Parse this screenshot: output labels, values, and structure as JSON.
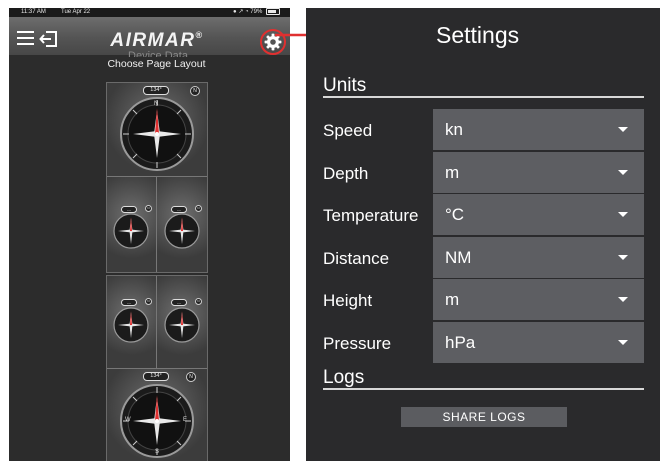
{
  "status_bar": {
    "time": "11:37 AM",
    "date": "Tue Apr 22",
    "indicators": "● ↗ ◔ 79%",
    "battery_percent": 79
  },
  "app_bar": {
    "logo_text": "AIRMAR",
    "logo_mark": "®",
    "subtitle": "Device Data",
    "menu_icon": "hamburger-icon",
    "exit_icon": "exit-icon",
    "settings_icon": "gear-icon"
  },
  "layout_picker": {
    "title": "Choose Page Layout",
    "layout1": {
      "big_heading": "134°",
      "badge": "N",
      "small_badge": "N",
      "small_pill": "---"
    },
    "layout2": {
      "big_heading": "134°",
      "badge": "N",
      "small_badge": "N",
      "small_pill": "---"
    },
    "dial_labels": [
      "N",
      "E",
      "S",
      "W"
    ]
  },
  "settings": {
    "title": "Settings",
    "units_heading": "Units",
    "rows": [
      {
        "label": "Speed",
        "value": "kn"
      },
      {
        "label": "Depth",
        "value": "m"
      },
      {
        "label": "Temperature",
        "value": "°C"
      },
      {
        "label": "Distance",
        "value": "NM"
      },
      {
        "label": "Height",
        "value": "m"
      },
      {
        "label": "Pressure",
        "value": "hPa"
      }
    ],
    "logs_heading": "Logs",
    "share_button": "SHARE LOGS"
  },
  "colors": {
    "highlight_red": "#e03030",
    "panel_bg": "#2a2a2c",
    "select_bg": "#5d5e62"
  }
}
